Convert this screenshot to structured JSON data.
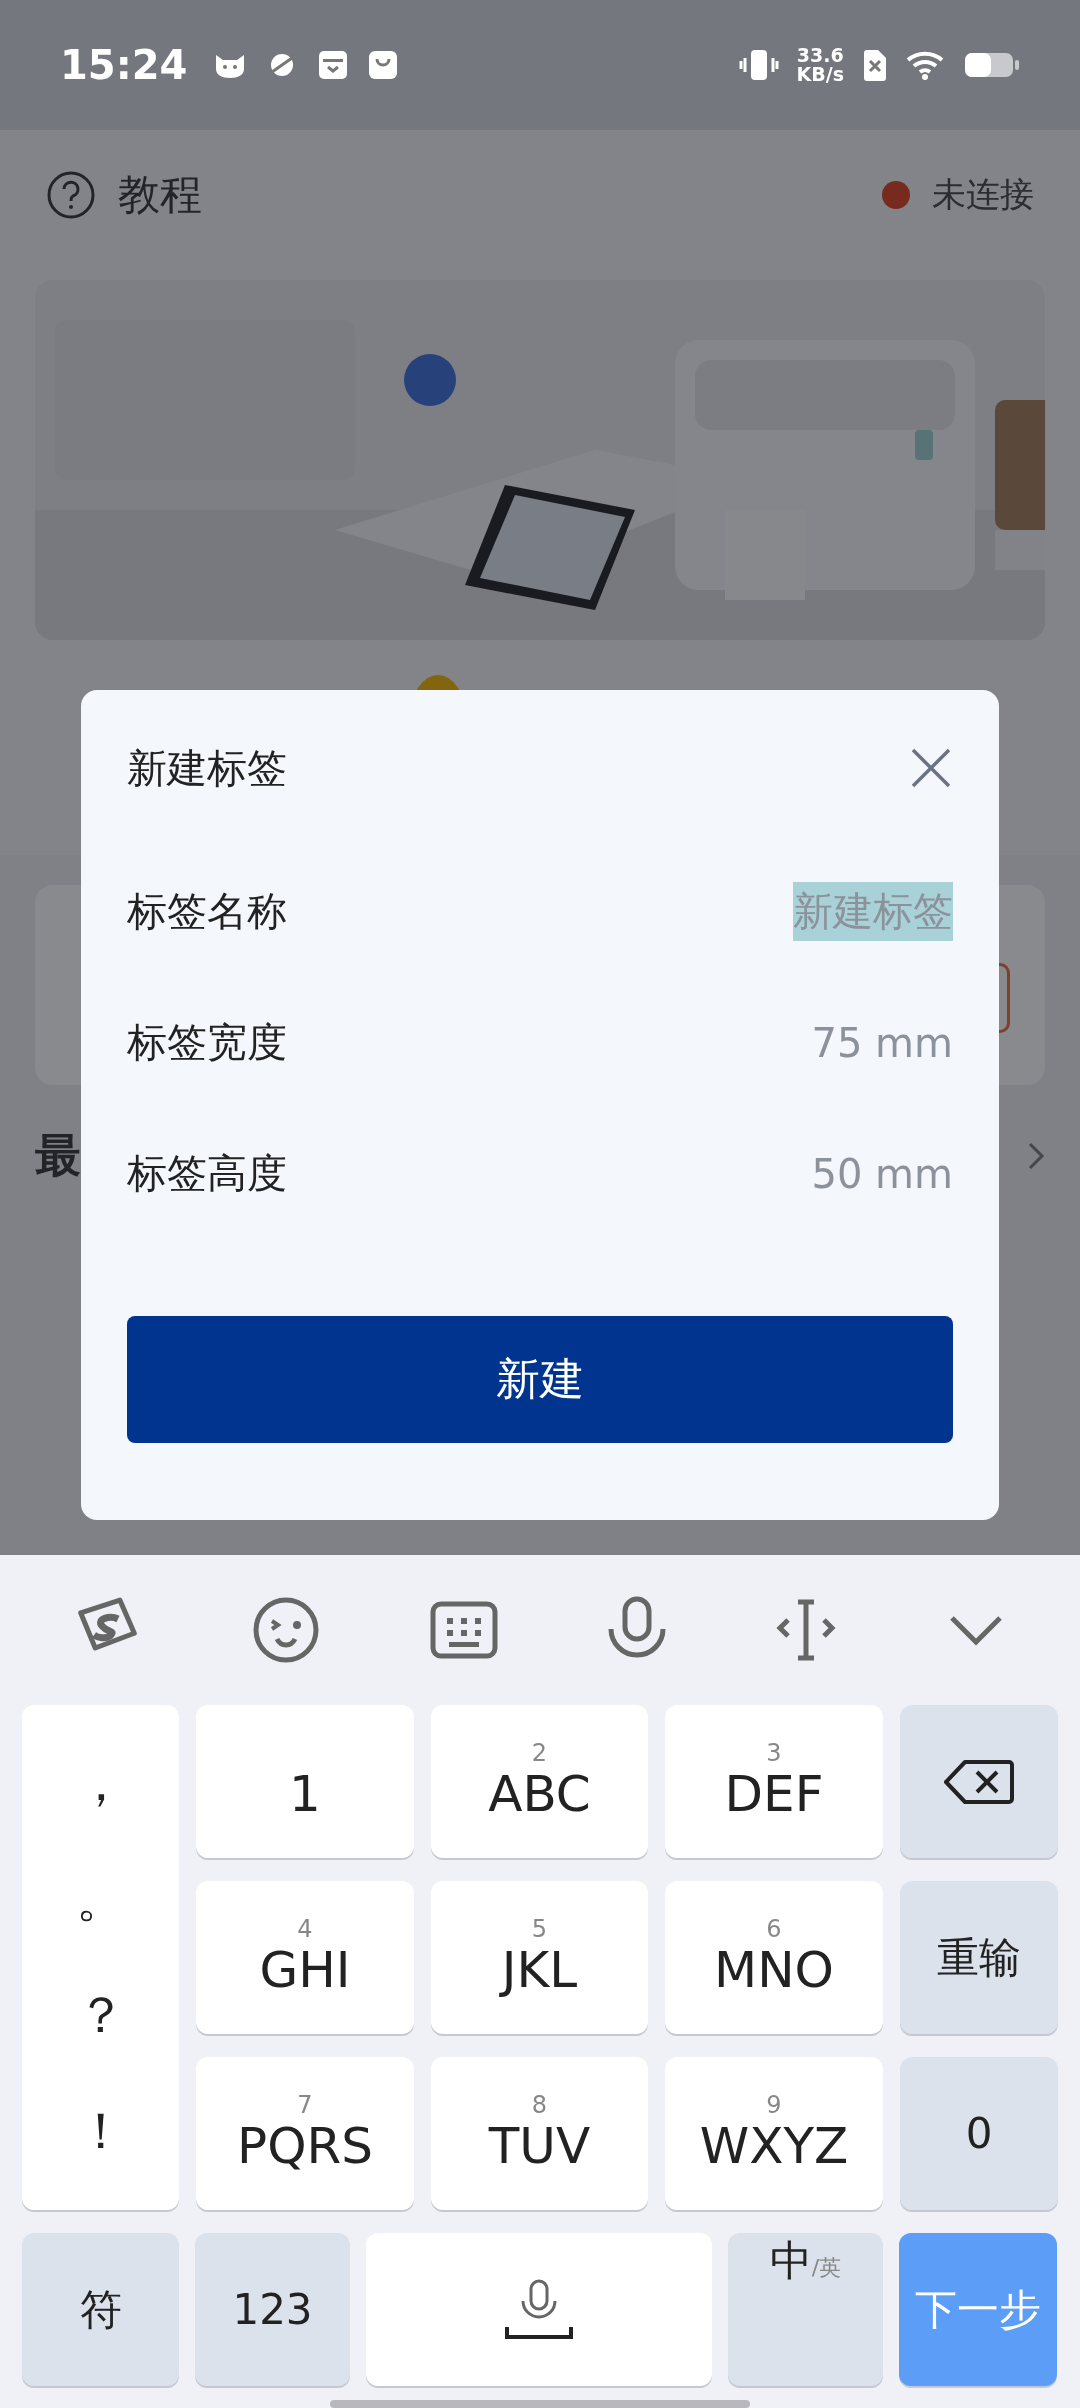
{
  "status_bar": {
    "time": "15:24",
    "speed_value": "33.6",
    "speed_unit": "KB/s"
  },
  "header": {
    "tutorial": "教程",
    "connection": "未连接"
  },
  "recent": {
    "title": "最"
  },
  "dialog": {
    "title": "新建标签",
    "fields": [
      {
        "label": "标签名称",
        "value": "新建标签",
        "selected": true
      },
      {
        "label": "标签宽度",
        "value": "75 mm",
        "selected": false
      },
      {
        "label": "标签高度",
        "value": "50 mm",
        "selected": false
      }
    ],
    "button": "新建"
  },
  "keyboard": {
    "punctuation": [
      "，",
      "。",
      "？",
      "！"
    ],
    "keys": [
      {
        "kind": "letter",
        "label": "1"
      },
      {
        "kind": "letter",
        "digit": "2",
        "label": "ABC"
      },
      {
        "kind": "letter",
        "digit": "3",
        "label": "DEF"
      },
      {
        "kind": "delete"
      },
      {
        "kind": "letter",
        "digit": "4",
        "label": "GHI"
      },
      {
        "kind": "letter",
        "digit": "5",
        "label": "JKL"
      },
      {
        "kind": "letter",
        "digit": "6",
        "label": "MNO"
      },
      {
        "kind": "function",
        "label": "重输"
      },
      {
        "kind": "letter",
        "digit": "7",
        "label": "PQRS"
      },
      {
        "kind": "letter",
        "digit": "8",
        "label": "TUV"
      },
      {
        "kind": "letter",
        "digit": "9",
        "label": "WXYZ"
      },
      {
        "kind": "function",
        "label": "0"
      }
    ],
    "bottom": [
      {
        "kind": "function",
        "label": "符"
      },
      {
        "kind": "function",
        "label": "123"
      },
      {
        "kind": "space"
      },
      {
        "kind": "lang",
        "label": "中",
        "sub": "/英"
      },
      {
        "kind": "primary",
        "label": "下一步"
      }
    ]
  }
}
